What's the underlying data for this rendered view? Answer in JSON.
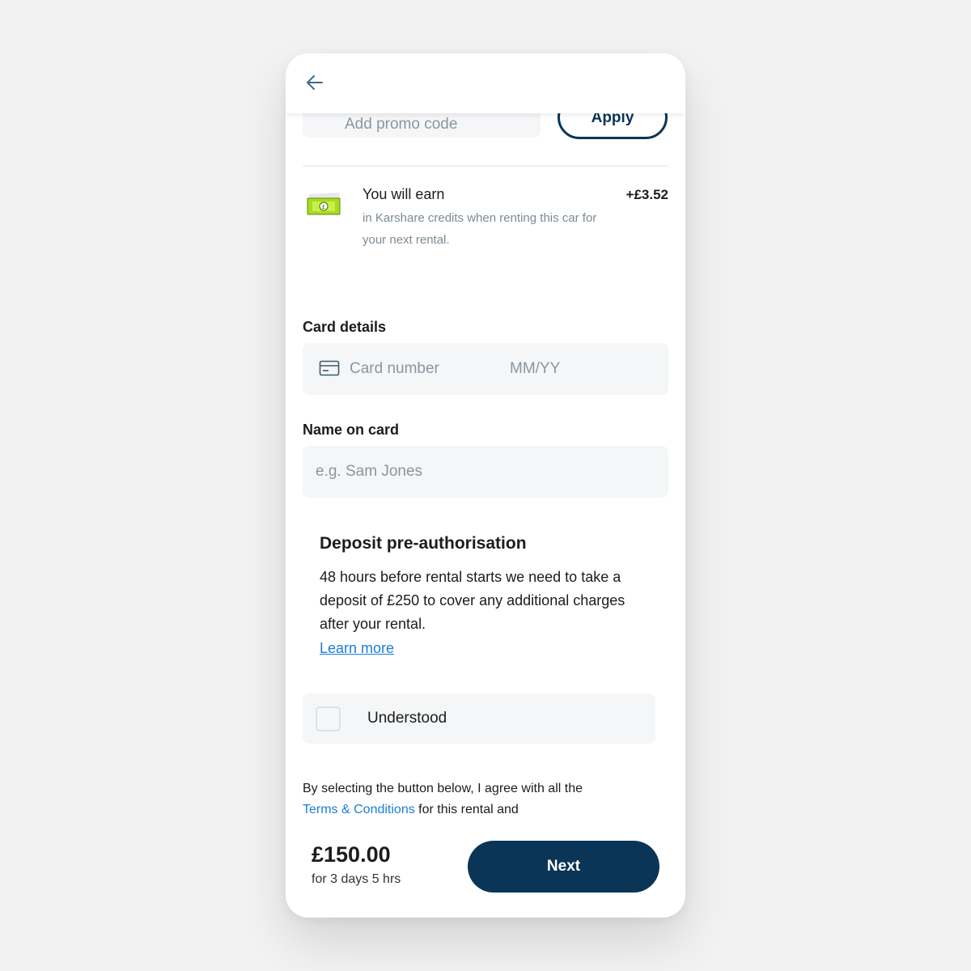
{
  "header": {
    "back_icon": "arrow-left-icon"
  },
  "promo": {
    "placeholder": "Add promo code",
    "apply_label": "Apply"
  },
  "earn": {
    "icon": "banknote-icon",
    "title": "You will earn",
    "description": "in Karshare credits when renting this car for your next rental.",
    "amount": "+£3.52"
  },
  "card": {
    "label": "Card details",
    "icon": "credit-card-icon",
    "number_placeholder": "Card number",
    "expiry_placeholder": "MM/YY"
  },
  "name": {
    "label": "Name on card",
    "placeholder": "e.g. Sam Jones"
  },
  "deposit": {
    "title": "Deposit pre-authorisation",
    "text": "48 hours before rental starts we need to take a deposit of £250 to cover any additional charges after your rental.",
    "link": "Learn more"
  },
  "understood": {
    "label": "Understood",
    "checked": false
  },
  "terms": {
    "before": "By selecting the button below, I agree with all the ",
    "link": "Terms & Conditions",
    "after": " for this rental and"
  },
  "footer": {
    "price": "£150.00",
    "duration": "for 3 days 5 hrs",
    "next_label": "Next"
  },
  "colors": {
    "primary": "#0a3556",
    "link": "#1a7fd8",
    "money_green": "#a8dc1e"
  }
}
